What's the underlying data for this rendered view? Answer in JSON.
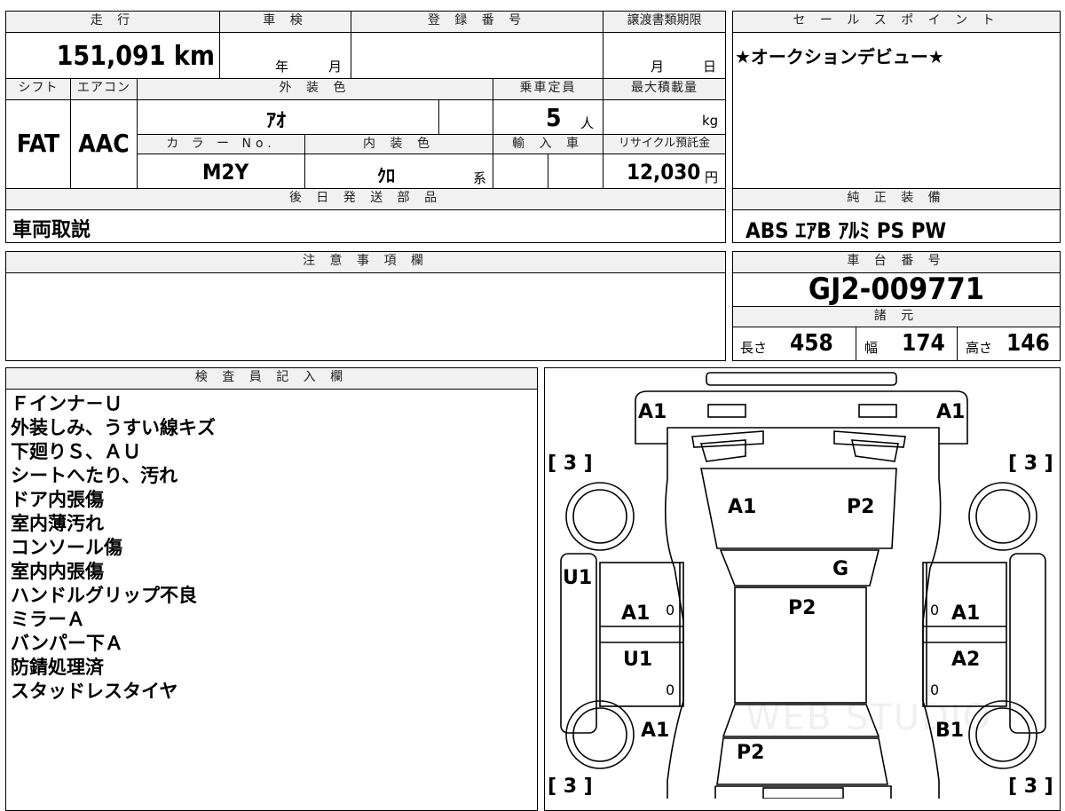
{
  "top_section": {
    "mileage_header": "走 行",
    "mileage": "151,091 km",
    "inspection_header": "車 検",
    "inspection_year": "年",
    "inspection_month": "月",
    "registration_header": "登 録 番 号",
    "transfer_header": "譲渡書類期限",
    "transfer_month": "月",
    "transfer_day": "日",
    "shift_header": "シフト",
    "shift": "FAT",
    "aircon_header": "エアコン",
    "aircon": "AAC",
    "exterior_header": "外 装 色",
    "exterior_color": "ｱｵ",
    "capacity_header": "乗車定員",
    "capacity": "5",
    "capacity_unit": "人",
    "load_header": "最大積載量",
    "load_unit": "kg",
    "color_no_header": "カ ラ ー No.",
    "color_no": "M2Y",
    "interior_header": "内 装 色",
    "interior_color": "ｸﾛ",
    "interior_suffix": "系",
    "import_header": "輸 入 車",
    "recycle_header": "リサイクル預託金",
    "recycle": "12,030",
    "recycle_unit": "円",
    "parts_header": "後 日 発 送 部 品",
    "parts": "車両取説"
  },
  "sales_point": {
    "header": "セ ー ル ス ポ イ ン ト",
    "text": "★オークションデビュー★"
  },
  "equipment": {
    "header": "純 正 装 備",
    "text": "ABS ｴｱB ｱﾙﾐ PS PW"
  },
  "caution": {
    "header": "注 意 事 項 欄"
  },
  "chassis": {
    "header": "車 台 番 号",
    "number": "GJ2-009771"
  },
  "specs": {
    "header": "諸 元",
    "length_label": "長さ",
    "length": "458",
    "width_label": "幅",
    "width": "174",
    "height_label": "高さ",
    "height": "146"
  },
  "inspector": {
    "header": "検 査 員 記 入 欄",
    "notes": [
      "Ｆインナ－Ｕ",
      "外装しみ、うすい線キズ",
      "下廻りＳ、ＡＵ",
      "シートへたり、汚れ",
      "ドア内張傷",
      "室内薄汚れ",
      "コンソール傷",
      "室内内張傷",
      "ハンドルグリップ不良",
      "ミラーＡ",
      "バンパー下Ａ",
      "防錆処理済",
      "スタッドレスタイヤ"
    ]
  },
  "diagram": {
    "front_left": "A1",
    "front_right": "A1",
    "tire_fl": "[ 3 ]",
    "tire_fr": "[ 3 ]",
    "tire_rl": "[ 3 ]",
    "tire_rr": "[ 3 ]",
    "hood_left": "A1",
    "hood_right": "P2",
    "glass": "G",
    "left_fender": "U1",
    "roof": "P2",
    "left_front_door": "A1",
    "right_front_door": "A1",
    "left_rear_door": "U1",
    "right_rear_door": "A2",
    "left_rear_quarter": "A1",
    "right_rear_quarter": "B1",
    "trunk": "P2",
    "door_mark": "0",
    "watermark": "WEB STUDIO"
  }
}
